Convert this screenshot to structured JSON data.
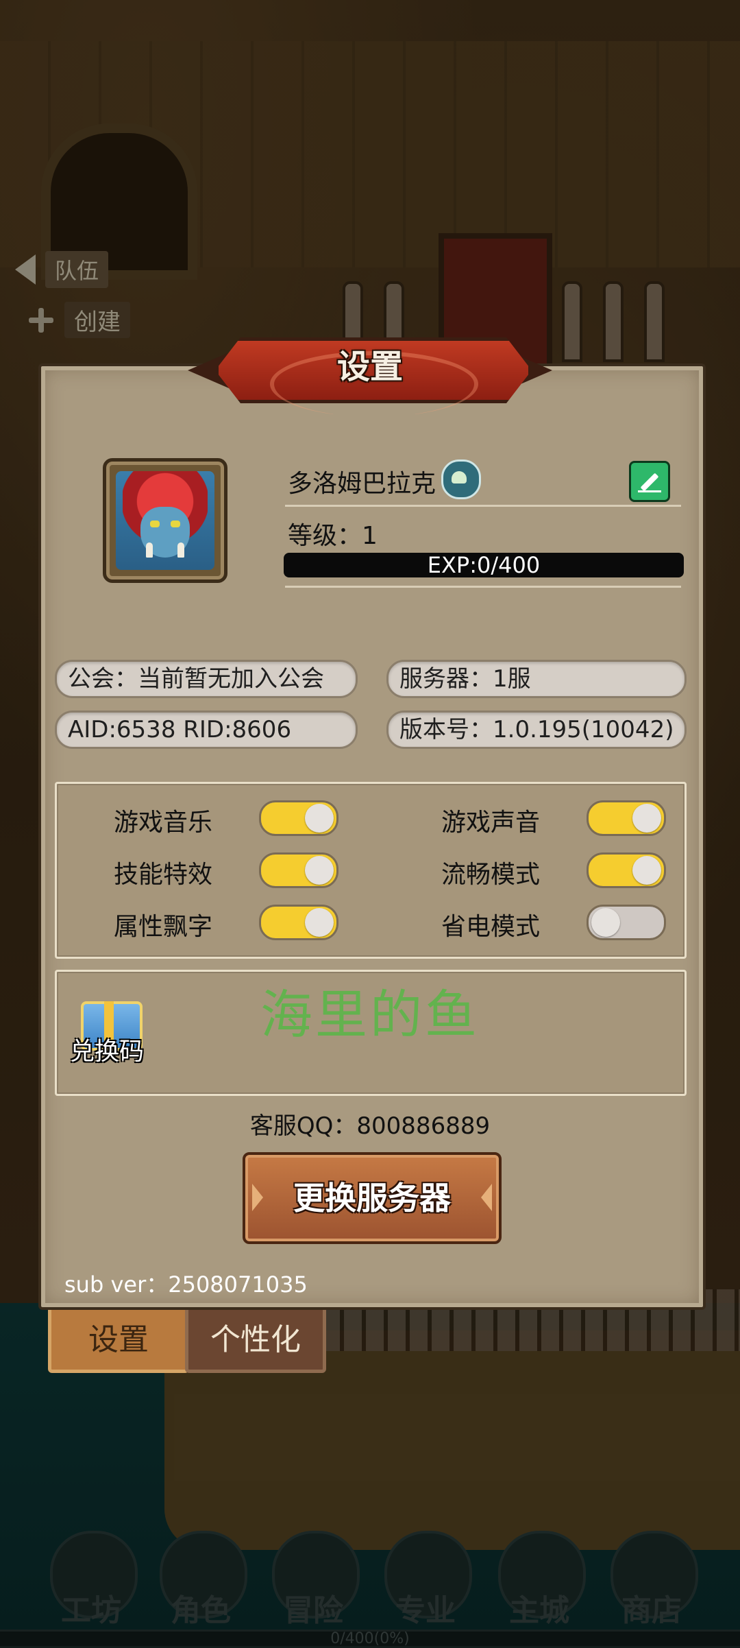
{
  "background": {
    "team_label": "队伍",
    "create_label": "创建"
  },
  "settings": {
    "title": "设置",
    "player": {
      "name": "多洛姆巴拉克",
      "level_text": "等级：1",
      "exp_text": "EXP:0/400",
      "exp_fraction": 0
    },
    "info": {
      "guild": "公会：当前暂无加入公会",
      "server": "服务器：1服",
      "ids": "AID:6538   RID:8606",
      "version": "版本号：1.0.195(10042)"
    },
    "toggles": [
      {
        "label": "游戏音乐",
        "on": true
      },
      {
        "label": "游戏声音",
        "on": true
      },
      {
        "label": "技能特效",
        "on": true
      },
      {
        "label": "流畅模式",
        "on": true
      },
      {
        "label": "属性飘字",
        "on": true
      },
      {
        "label": "省电模式",
        "on": false
      }
    ],
    "redeem_label": "兑换码",
    "watermark": "海里的鱼",
    "service_qq": "客服QQ：800886889",
    "switch_server_label": "更换服务器",
    "sub_ver": "sub ver：2508071035"
  },
  "tabs": {
    "settings": "设置",
    "personalize": "个性化"
  },
  "bottom_nav": {
    "items": [
      "工坊",
      "角色",
      "冒险",
      "专业",
      "主城",
      "商店"
    ],
    "progress": "0/400(0%)"
  },
  "colors": {
    "toggle_on": "#f5cd2f",
    "toggle_off": "#cfc8c3",
    "panel": "#a99a80",
    "banner": "#b3321e",
    "edit_button": "#2eb86a",
    "watermark": "#5cb64a"
  }
}
